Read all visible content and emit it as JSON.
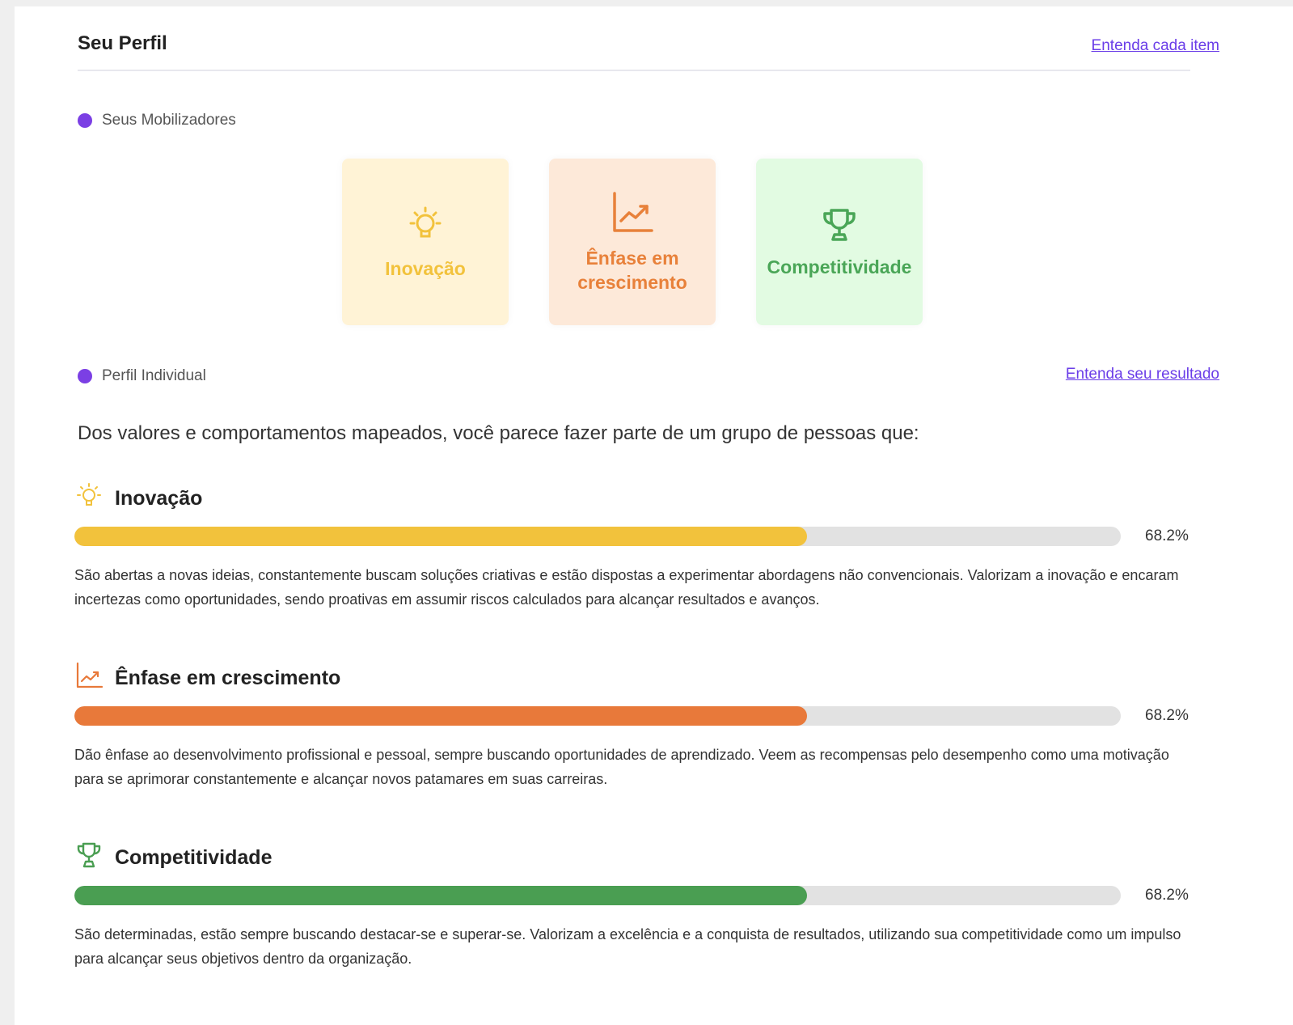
{
  "header": {
    "title": "Seu Perfil",
    "link": "Entenda cada item"
  },
  "mobilizers": {
    "label": "Seus Mobilizadores",
    "tiles": [
      {
        "label": "Inovação",
        "icon": "lightbulb-icon",
        "color": "#f2c23c",
        "bg": "#fff3d6"
      },
      {
        "label": "Ênfase em crescimento",
        "icon": "growth-chart-icon",
        "color": "#e8813a",
        "bg": "#fde9d9"
      },
      {
        "label": "Competitividade",
        "icon": "trophy-icon",
        "color": "#4aa657",
        "bg": "#e2fbe2"
      }
    ]
  },
  "individual": {
    "label": "Perfil Individual",
    "link": "Entenda seu resultado",
    "intro": "Dos valores e comportamentos mapeados, você parece fazer parte de um grupo de pessoas que:",
    "items": [
      {
        "title": "Inovação",
        "icon": "lightbulb-icon",
        "color": "#f2c23c",
        "percent_label": "68.2%",
        "fill_fraction": 0.7,
        "description": "São abertas a novas ideias, constantemente buscam soluções criativas e estão dispostas a experimentar abordagens não convencionais. Valorizam a inovação e encaram incertezas como oportunidades, sendo proativas em assumir riscos calculados para alcançar resultados e avanços."
      },
      {
        "title": "Ênfase em crescimento",
        "icon": "growth-chart-icon",
        "color": "#e8793a",
        "percent_label": "68.2%",
        "fill_fraction": 0.7,
        "description": "Dão ênfase ao desenvolvimento profissional e pessoal, sempre buscando oportunidades de aprendizado. Veem as recompensas pelo desempenho como uma motivação para se aprimorar constantemente e alcançar novos patamares em suas carreiras."
      },
      {
        "title": "Competitividade",
        "icon": "trophy-icon",
        "color": "#4a9e52",
        "percent_label": "68.2%",
        "fill_fraction": 0.7,
        "description": "São determinadas, estão sempre buscando destacar-se e superar-se. Valorizam a excelência e a conquista de resultados, utilizando sua competitividade como um impulso para alcançar seus objetivos dentro da organização."
      }
    ]
  }
}
